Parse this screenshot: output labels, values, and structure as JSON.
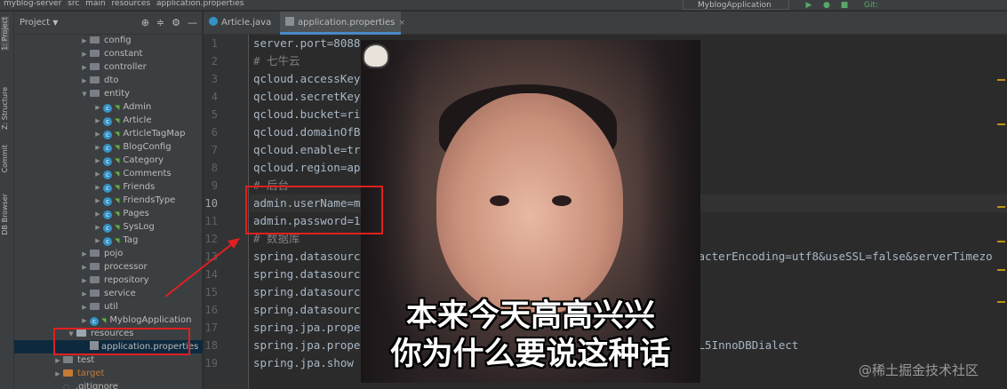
{
  "titlebar": {
    "breadcrumbs": [
      "myblog-server",
      "src",
      "main",
      "resources",
      "application.properties"
    ],
    "run_config": "MyblogApplication",
    "git_label": "Git:"
  },
  "tool_strip": {
    "items": [
      "1: Project",
      "Z: Structure",
      "Commit",
      "DB Browser"
    ]
  },
  "project_panel": {
    "title": "Project",
    "header_icons": [
      "target-icon",
      "collapse-icon",
      "gear-icon",
      "minimize-icon"
    ],
    "tree": [
      {
        "label": "config",
        "type": "folder",
        "depth": 3
      },
      {
        "label": "constant",
        "type": "folder",
        "depth": 3
      },
      {
        "label": "controller",
        "type": "folder",
        "depth": 3
      },
      {
        "label": "dto",
        "type": "folder",
        "depth": 3
      },
      {
        "label": "entity",
        "type": "folder",
        "depth": 3,
        "expanded": true
      },
      {
        "label": "Admin",
        "type": "class",
        "depth": 4
      },
      {
        "label": "Article",
        "type": "class",
        "depth": 4
      },
      {
        "label": "ArticleTagMap",
        "type": "class",
        "depth": 4
      },
      {
        "label": "BlogConfig",
        "type": "class",
        "depth": 4
      },
      {
        "label": "Category",
        "type": "class",
        "depth": 4
      },
      {
        "label": "Comments",
        "type": "class",
        "depth": 4
      },
      {
        "label": "Friends",
        "type": "class",
        "depth": 4
      },
      {
        "label": "FriendsType",
        "type": "class",
        "depth": 4
      },
      {
        "label": "Pages",
        "type": "class",
        "depth": 4
      },
      {
        "label": "SysLog",
        "type": "class",
        "depth": 4
      },
      {
        "label": "Tag",
        "type": "class",
        "depth": 4
      },
      {
        "label": "pojo",
        "type": "folder",
        "depth": 3
      },
      {
        "label": "processor",
        "type": "folder",
        "depth": 3
      },
      {
        "label": "repository",
        "type": "folder",
        "depth": 3
      },
      {
        "label": "service",
        "type": "folder",
        "depth": 3
      },
      {
        "label": "util",
        "type": "folder",
        "depth": 3
      },
      {
        "label": "MyblogApplication",
        "type": "class",
        "depth": 3
      },
      {
        "label": "resources",
        "type": "resfolder",
        "depth": 2,
        "expanded": true
      },
      {
        "label": "application.properties",
        "type": "properties",
        "depth": 3,
        "selected": true
      },
      {
        "label": "test",
        "type": "folder",
        "depth": 1
      },
      {
        "label": "target",
        "type": "orangefolder",
        "depth": 1
      },
      {
        "label": ".gitignore",
        "type": "file",
        "depth": 1
      }
    ]
  },
  "tabs": [
    {
      "label": "Article.java",
      "active": false
    },
    {
      "label": "application.properties",
      "active": true
    }
  ],
  "editor": {
    "current_line": 10,
    "lines": [
      {
        "n": "1",
        "text": "server.port=8088"
      },
      {
        "n": "2",
        "text": "# 七牛云",
        "comment": true
      },
      {
        "n": "3",
        "text": "qcloud.accessKey="
      },
      {
        "n": "4",
        "text": "qcloud.secretKey="
      },
      {
        "n": "5",
        "text": "qcloud.bucket=ri"
      },
      {
        "n": "6",
        "text": "qcloud.domainOfB"
      },
      {
        "n": "7",
        "text": "qcloud.enable=tr"
      },
      {
        "n": "8",
        "text": "qcloud.region=ap"
      },
      {
        "n": "9",
        "text": "# 后台",
        "comment": true
      },
      {
        "n": "10",
        "text": "admin.userName=m"
      },
      {
        "n": "11",
        "text": "admin.password=1"
      },
      {
        "n": "12",
        "text": "# 数据库",
        "comment": true
      },
      {
        "n": "13",
        "text": "spring.datasourc",
        "tail": "racterEncoding=utf8&useSSL=false&serverTimezo"
      },
      {
        "n": "14",
        "text": "spring.datasourc"
      },
      {
        "n": "15",
        "text": "spring.datasourc"
      },
      {
        "n": "16",
        "text": "spring.datasourc"
      },
      {
        "n": "17",
        "text": "spring.jpa.prope"
      },
      {
        "n": "18",
        "text": "spring.jpa.prope",
        "tail": "QL5InnoDBDialect"
      },
      {
        "n": "19",
        "text": "spring.jpa.show"
      }
    ]
  },
  "meme": {
    "caption_line1": "本来今天高高兴兴",
    "caption_line2": "你为什么要说这种话"
  },
  "watermark": "@稀土掘金技术社区",
  "colors": {
    "highlight_box": "#e02020",
    "accent": "#4a88c7",
    "comment": "#808080"
  }
}
